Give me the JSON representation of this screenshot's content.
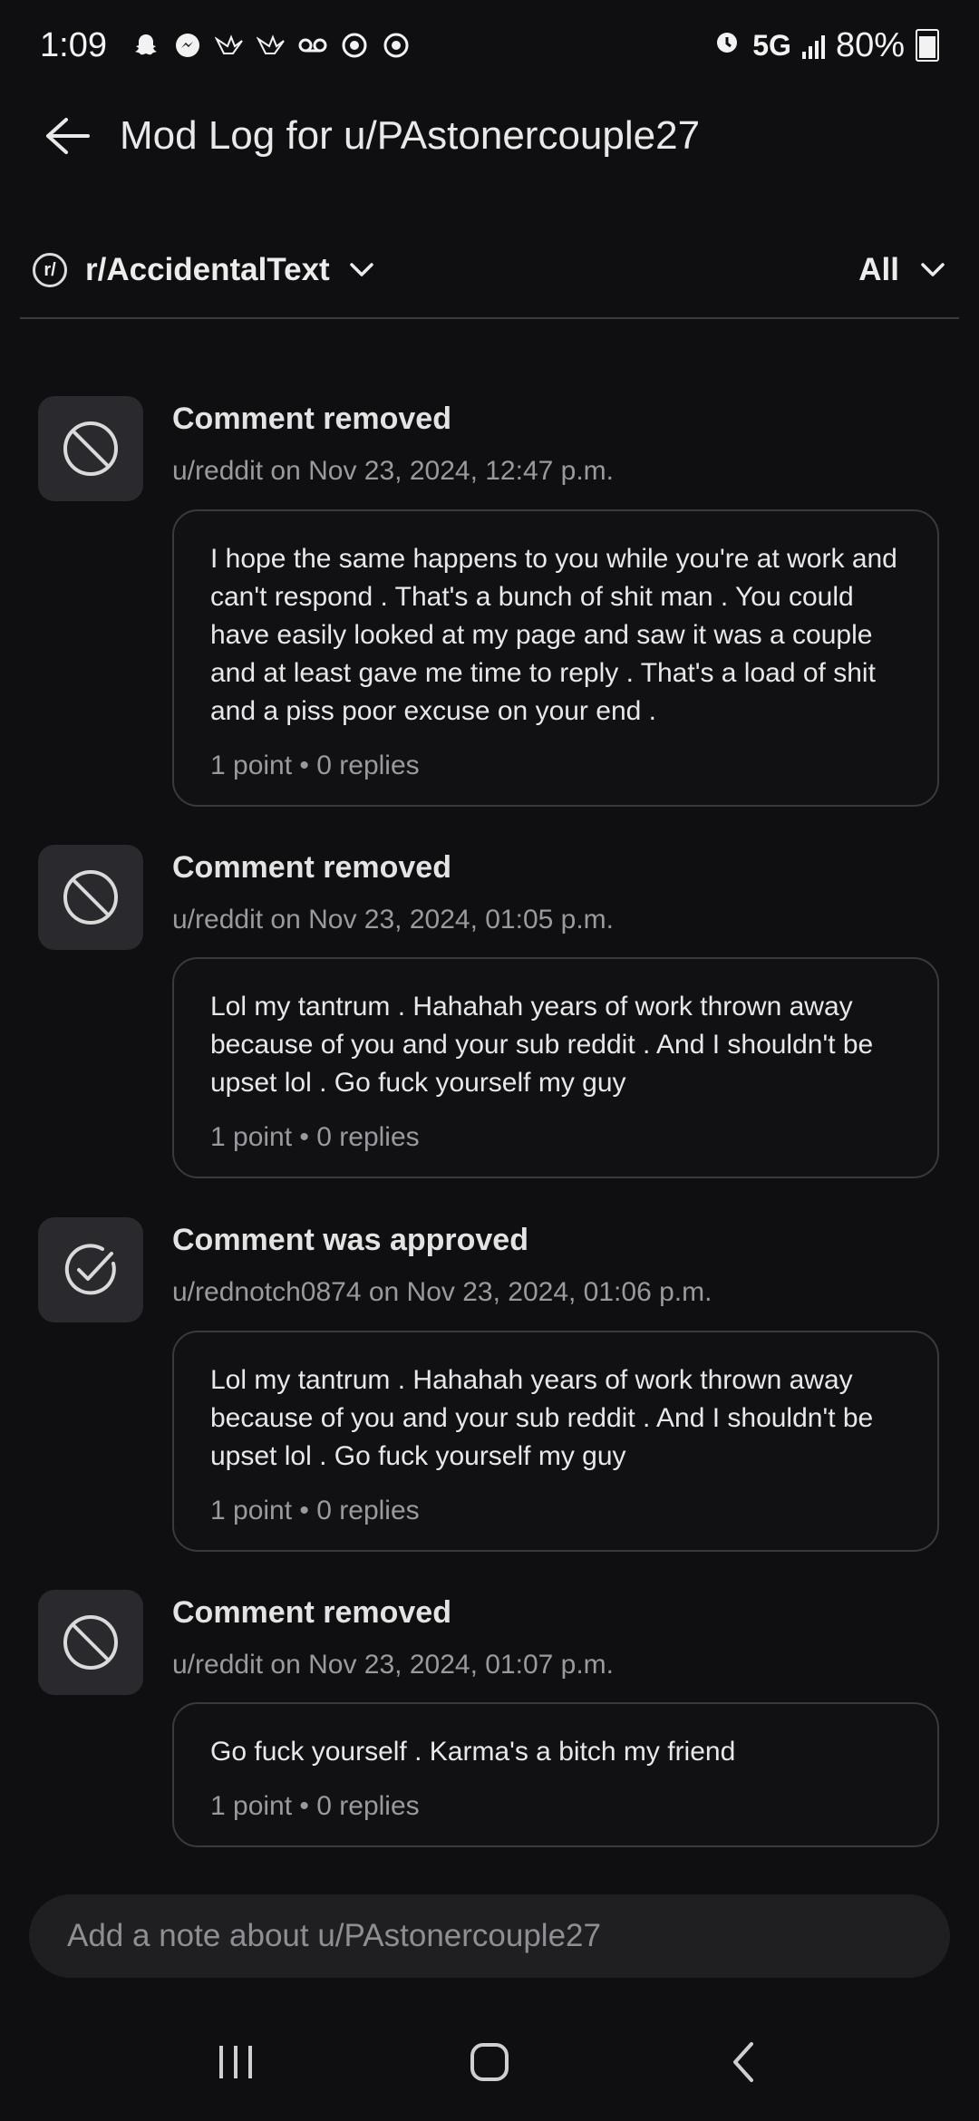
{
  "status_bar": {
    "time": "1:09",
    "network": "5G",
    "battery": "80%",
    "icons": [
      "snapchat-icon",
      "messenger-icon",
      "bird-icon",
      "bird-icon",
      "voicemail-icon",
      "chrome-icon",
      "chrome-icon"
    ]
  },
  "header": {
    "title": "Mod Log for u/PAstonercouple27"
  },
  "filters": {
    "subreddit": "r/AccidentalText",
    "subreddit_icon": "r/",
    "action_filter": "All"
  },
  "entries": [
    {
      "icon": "removed-icon",
      "title": "Comment removed",
      "meta": "u/reddit on Nov 23, 2024, 12:47 p.m.",
      "text": "I hope the same happens to you while you're at work and can't respond . That's a bunch of shit man . You could have easily looked at my page and saw it was a couple and at least gave me time to reply . That's a load of shit and a piss poor excuse on your end .",
      "stats": "1 point • 0 replies"
    },
    {
      "icon": "removed-icon",
      "title": "Comment removed",
      "meta": "u/reddit on Nov 23, 2024, 01:05 p.m.",
      "text": "Lol my tantrum . Hahahah years of work thrown away because of you and your sub reddit . And I shouldn't be upset lol . Go fuck yourself my guy",
      "stats": "1 point • 0 replies"
    },
    {
      "icon": "approved-icon",
      "title": "Comment was approved",
      "meta": "u/rednotch0874 on Nov 23, 2024, 01:06 p.m.",
      "text": "Lol my tantrum . Hahahah years of work thrown away because of you and your sub reddit . And I shouldn't be upset lol . Go fuck yourself my guy",
      "stats": "1 point • 0 replies"
    },
    {
      "icon": "removed-icon",
      "title": "Comment removed",
      "meta": "u/reddit on Nov 23, 2024, 01:07 p.m.",
      "text": "Go fuck yourself . Karma's a bitch my friend",
      "stats": "1 point • 0 replies"
    }
  ],
  "note": {
    "placeholder": "Add a note about u/PAstonercouple27"
  }
}
